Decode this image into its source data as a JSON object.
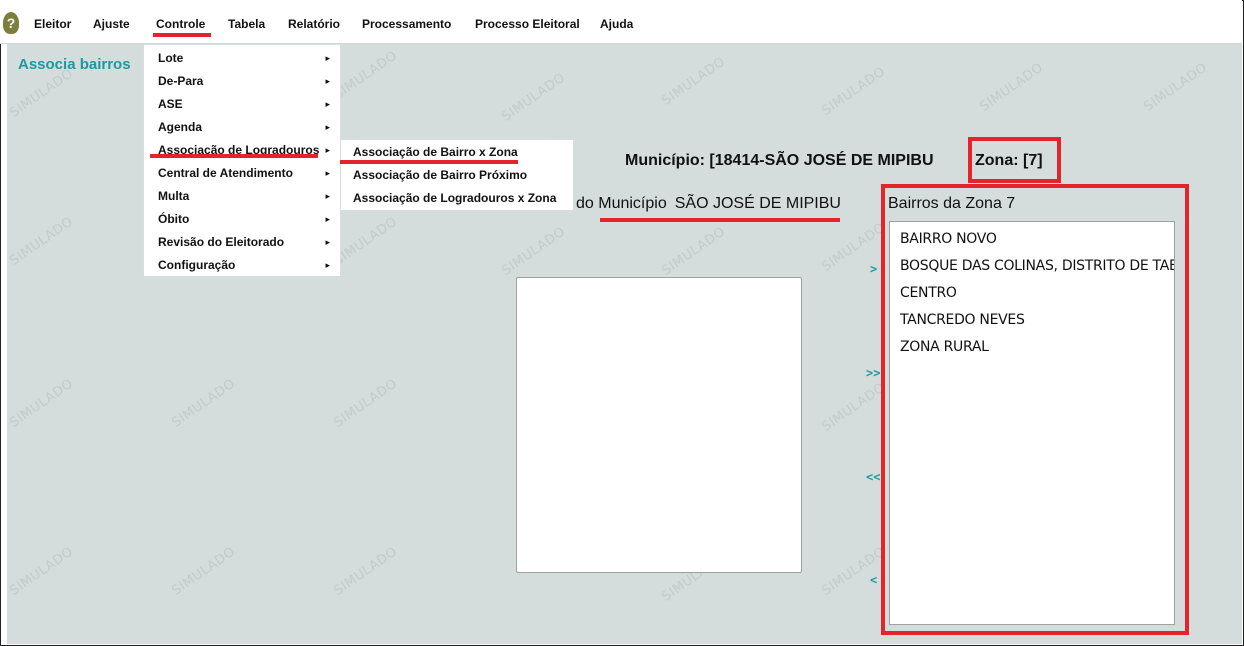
{
  "menubar": {
    "logo_glyph": "?",
    "items": [
      "Eleitor",
      "Ajuste",
      "Controle",
      "Tabela",
      "Relatório",
      "Processamento",
      "Processo Eleitoral",
      "Ajuda"
    ]
  },
  "page": {
    "title": "Associa bairros"
  },
  "watermark": "SIMULADO",
  "controle_menu": {
    "items": [
      "Lote",
      "De-Para",
      "ASE",
      "Agenda",
      "Associação de Logradouros",
      "Central de Atendimento",
      "Multa",
      "Óbito",
      "Revisão do Eleitorado",
      "Configuração"
    ],
    "arrow_glyph": "▸"
  },
  "logradouros_submenu": {
    "items": [
      "Associação de Bairro x Zona",
      "Associação de Bairro Próximo",
      "Associação de Logradouros x Zona"
    ]
  },
  "header": {
    "municipio": "Município: [18414-SÃO JOSÉ DE MIPIBU",
    "zona": "Zona: [7]"
  },
  "left_list": {
    "label_prefix": "do Município",
    "label_name": "SÃO JOSÉ DE MIPIBU"
  },
  "right_list": {
    "label": "Bairros da Zona  7",
    "items": [
      "BAIRRO NOVO",
      "BOSQUE DAS COLINAS, DISTRITO DE TABOCA",
      "CENTRO",
      "TANCREDO NEVES",
      "ZONA RURAL"
    ]
  },
  "move_buttons": {
    "add_one": ">",
    "add_all": ">>",
    "remove_all": "<<",
    "remove_one": "<"
  },
  "colors": {
    "annotation_red": "#e4242b",
    "accent_teal": "#1a9aa0",
    "background": "#d4dcdc"
  }
}
